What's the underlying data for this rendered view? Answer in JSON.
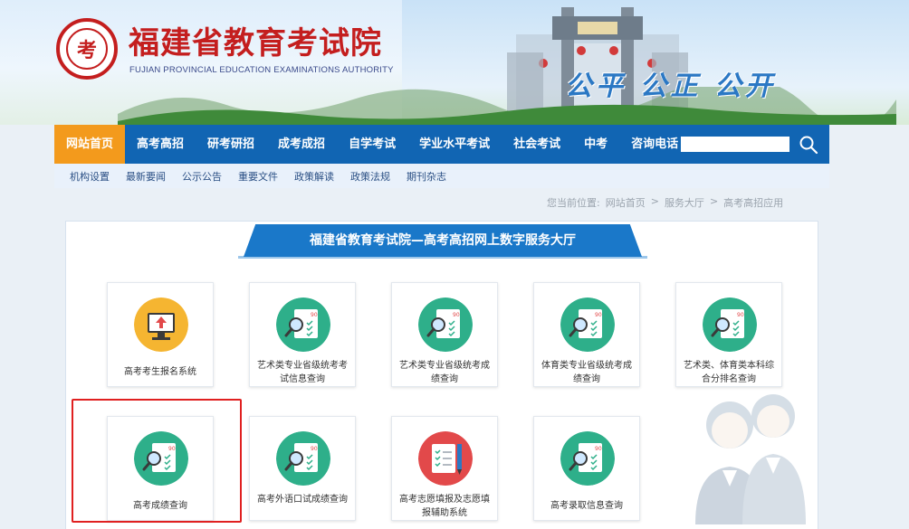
{
  "header": {
    "title": "福建省教育考试院",
    "subtitle": "FUJIAN PROVINCIAL EDUCATION EXAMINATIONS AUTHORITY",
    "motto": "公平 公正 公开"
  },
  "nav": {
    "items": [
      {
        "label": "网站首页",
        "active": true
      },
      {
        "label": "高考高招",
        "active": false
      },
      {
        "label": "研考研招",
        "active": false
      },
      {
        "label": "成考成招",
        "active": false
      },
      {
        "label": "自学考试",
        "active": false
      },
      {
        "label": "学业水平考试",
        "active": false
      },
      {
        "label": "社会考试",
        "active": false
      },
      {
        "label": "中考",
        "active": false
      },
      {
        "label": "咨询电话",
        "active": false
      }
    ],
    "search_value": "",
    "search_icon": "search-icon"
  },
  "subnav": {
    "items": [
      "机构设置",
      "最新要闻",
      "公示公告",
      "重要文件",
      "政策解读",
      "政策法规",
      "期刊杂志"
    ]
  },
  "breadcrumb": {
    "prefix": "您当前位置:",
    "items": [
      "网站首页",
      "服务大厅",
      "高考高招应用"
    ],
    "separator": ">"
  },
  "panel": {
    "title": "福建省教育考试院—高考高招网上数字服务大厅",
    "cards": [
      {
        "label": "高考考生报名系统",
        "icon": "registration-monitor-icon"
      },
      {
        "label": "艺术类专业省级统考考试信息查询",
        "icon": "score-report-icon"
      },
      {
        "label": "艺术类专业省级统考成绩查询",
        "icon": "score-report-icon"
      },
      {
        "label": "体育类专业省级统考成绩查询",
        "icon": "score-report-icon"
      },
      {
        "label": "艺术类、体育类本科综合分排名查询",
        "icon": "score-report-icon"
      },
      {
        "label": "高考成绩查询",
        "icon": "score-report-icon"
      },
      {
        "label": "高考外语口试成绩查询",
        "icon": "score-report-icon"
      },
      {
        "label": "高考志愿填报及志愿填报辅助系统",
        "icon": "checklist-pencil-icon"
      },
      {
        "label": "高考录取信息查询",
        "icon": "score-report-icon"
      }
    ]
  },
  "colors": {
    "nav_blue": "#1165b3",
    "nav_active": "#f39a1c",
    "title_red": "#c41e1e",
    "icon_green": "#2eaf8a",
    "icon_yellow": "#f5b531",
    "icon_red": "#e2494a",
    "highlight_red": "#e02020"
  }
}
